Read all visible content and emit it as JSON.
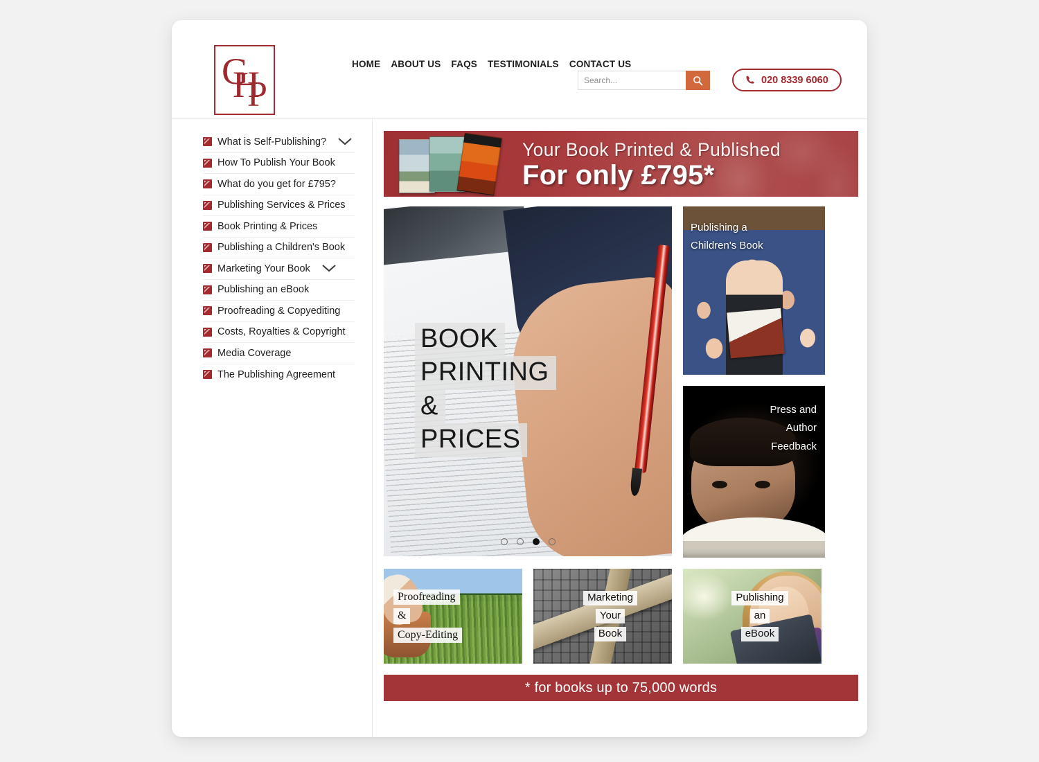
{
  "header": {
    "logo_letters": [
      "G",
      "H",
      "P"
    ],
    "nav": [
      {
        "label": "HOME",
        "name": "home"
      },
      {
        "label": "ABOUT US",
        "name": "about-us"
      },
      {
        "label": "FAQS",
        "name": "faqs"
      },
      {
        "label": "TESTIMONIALS",
        "name": "testimonials"
      },
      {
        "label": "CONTACT US",
        "name": "contact-us"
      }
    ],
    "search": {
      "placeholder": "Search...",
      "value": "",
      "icon": "search-icon"
    },
    "phone": {
      "number": "020 8339 6060",
      "icon": "phone-icon"
    }
  },
  "sidebar": {
    "items": [
      {
        "label": "What is Self-Publishing?",
        "expandable": true
      },
      {
        "label": "How To Publish Your Book",
        "expandable": false
      },
      {
        "label": "What do you get for £795?",
        "expandable": false
      },
      {
        "label": "Publishing Services & Prices",
        "expandable": false
      },
      {
        "label": "Book Printing & Prices",
        "expandable": false
      },
      {
        "label": "Publishing a Children's Book",
        "expandable": false
      },
      {
        "label": "Marketing Your Book",
        "expandable": true
      },
      {
        "label": "Publishing an eBook",
        "expandable": false
      },
      {
        "label": "Proofreading & Copyediting",
        "expandable": false
      },
      {
        "label": "Costs, Royalties & Copyright",
        "expandable": false
      },
      {
        "label": "Media Coverage",
        "expandable": false
      },
      {
        "label": "The Publishing Agreement",
        "expandable": false
      }
    ]
  },
  "promo": {
    "line1": "Your Book Printed & Published",
    "line2": "For only £795*"
  },
  "hero": {
    "caption_lines": [
      "BOOK",
      "PRINTING",
      "&",
      "PRICES"
    ],
    "dots_total": 4,
    "dot_active_index": 3
  },
  "tiles": {
    "children": {
      "caption_lines": [
        "Publishing a",
        "Children's Book"
      ]
    },
    "press": {
      "caption_lines": [
        "Press and",
        "Author",
        "Feedback"
      ]
    },
    "proofreading": {
      "caption_lines": [
        "Proofreading",
        "&",
        "Copy-Editing"
      ]
    },
    "marketing": {
      "caption_lines": [
        "Marketing",
        "Your",
        "Book"
      ]
    },
    "ebook": {
      "caption_lines": [
        "Publishing",
        "an",
        "eBook"
      ]
    }
  },
  "footer": {
    "note": "* for books up to 75,000 words"
  },
  "colors": {
    "brand_red": "#a32a2f",
    "banner_red": "#a83a3c",
    "footer_red": "#a33437",
    "search_orange": "#d2693c"
  }
}
